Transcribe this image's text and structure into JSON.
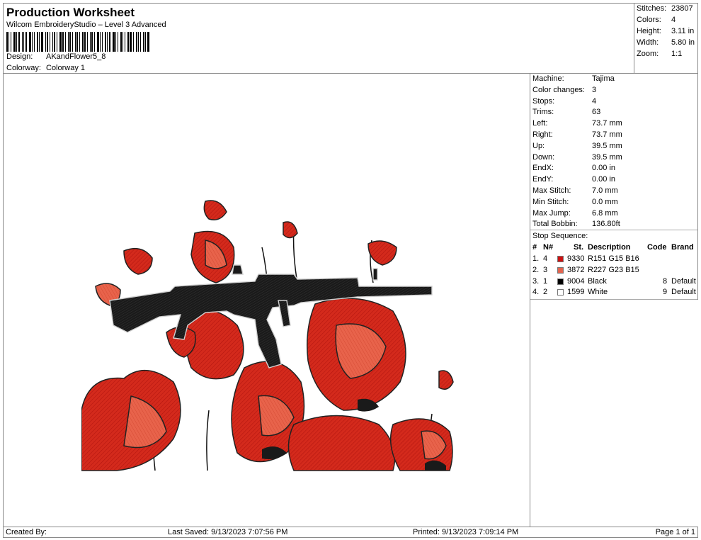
{
  "header": {
    "title": "Production Worksheet",
    "subtitle": "Wilcom EmbroideryStudio – Level 3 Advanced",
    "design_label": "Design:",
    "design_value": "AKandFlower5_8",
    "colorway_label": "Colorway:",
    "colorway_value": "Colorway 1"
  },
  "stats": [
    {
      "label": "Stitches:",
      "value": "23807"
    },
    {
      "label": "Colors:",
      "value": "4"
    },
    {
      "label": "Height:",
      "value": "3.11 in"
    },
    {
      "label": "Width:",
      "value": "5.80 in"
    },
    {
      "label": "Zoom:",
      "value": "1:1"
    }
  ],
  "machine_info": [
    {
      "label": "Machine:",
      "value": "Tajima"
    },
    {
      "label": "Color changes:",
      "value": "3"
    },
    {
      "label": "Stops:",
      "value": "4"
    },
    {
      "label": "Trims:",
      "value": "63"
    },
    {
      "label": "Left:",
      "value": "73.7 mm"
    },
    {
      "label": "Right:",
      "value": "73.7 mm"
    },
    {
      "label": "Up:",
      "value": "39.5 mm"
    },
    {
      "label": "Down:",
      "value": "39.5 mm"
    },
    {
      "label": "EndX:",
      "value": "0.00 in"
    },
    {
      "label": "EndY:",
      "value": "0.00 in"
    },
    {
      "label": "Max Stitch:",
      "value": "7.0 mm"
    },
    {
      "label": "Min Stitch:",
      "value": "0.0 mm"
    },
    {
      "label": "Max Jump:",
      "value": "6.8 mm"
    },
    {
      "label": "Total Bobbin:",
      "value": "136.80ft"
    }
  ],
  "stop_sequence": {
    "title": "Stop Sequence:",
    "columns": [
      "#",
      "N#",
      "St.",
      "Description",
      "Code",
      "Brand"
    ],
    "rows": [
      {
        "num": "1.",
        "n": "4",
        "color": "#cc1111",
        "st": "9330",
        "desc": "R151 G15 B16",
        "code": "",
        "brand": ""
      },
      {
        "num": "2.",
        "n": "3",
        "color": "#e3644f",
        "st": "3872",
        "desc": "R227 G23 B15",
        "code": "",
        "brand": ""
      },
      {
        "num": "3.",
        "n": "1",
        "color": "#000000",
        "st": "9004",
        "desc": "Black",
        "code": "8",
        "brand": "Default"
      },
      {
        "num": "4.",
        "n": "2",
        "color": "#ffffff",
        "st": "1599",
        "desc": "White",
        "code": "9",
        "brand": "Default"
      }
    ]
  },
  "footer": {
    "created_by": "Created By:",
    "last_saved": "Last Saved: 9/13/2023 7:07:56 PM",
    "printed": "Printed: 9/13/2023 7:09:14 PM",
    "page": "Page 1 of 1"
  }
}
